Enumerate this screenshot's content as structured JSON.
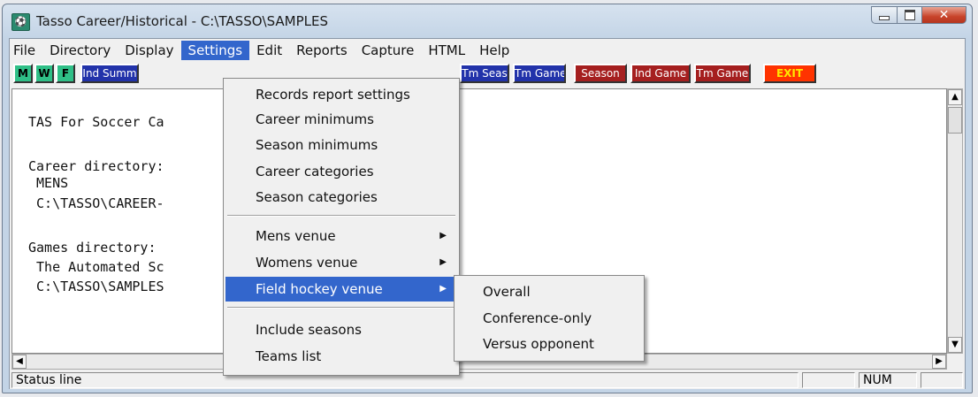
{
  "window": {
    "title": "Tasso Career/Historical - C:\\TASSO\\SAMPLES",
    "app_icon_glyph": "⚽"
  },
  "menubar": {
    "items": [
      "File",
      "Directory",
      "Display",
      "Settings",
      "Edit",
      "Reports",
      "Capture",
      "HTML",
      "Help"
    ],
    "active": "Settings"
  },
  "toolbar": {
    "buttons": [
      {
        "label": "M",
        "color": "green"
      },
      {
        "label": "W",
        "color": "green"
      },
      {
        "label": "F",
        "color": "green"
      },
      {
        "label": "Ind Summ",
        "color": "blue"
      },
      {
        "label": "Tm Seas",
        "color": "blue"
      },
      {
        "label": "Tm Game",
        "color": "blue"
      },
      {
        "label": "Season",
        "color": "red"
      },
      {
        "label": "Ind Game",
        "color": "red"
      },
      {
        "label": "Tm Game",
        "color": "red"
      },
      {
        "label": "EXIT",
        "color": "exit"
      }
    ]
  },
  "content": {
    "lines": [
      "TAS For Soccer Ca",
      "Career directory:",
      " MENS",
      " C:\\TASSO\\CAREER-",
      "Games directory:",
      " The Automated Sc",
      " C:\\TASSO\\SAMPLES"
    ]
  },
  "settings_menu": {
    "items": [
      {
        "label": "Records report settings"
      },
      {
        "label": "Career minimums"
      },
      {
        "label": "Season minimums"
      },
      {
        "label": "Career categories"
      },
      {
        "label": "Season categories"
      },
      {
        "label": "Mens venue",
        "submenu": true
      },
      {
        "label": "Womens venue",
        "submenu": true
      },
      {
        "label": "Field hockey venue",
        "submenu": true,
        "highlighted": true
      },
      {
        "label": "Include seasons"
      },
      {
        "label": "Teams list"
      }
    ]
  },
  "venue_submenu": {
    "items": [
      "Overall",
      "Conference-only",
      "Versus opponent"
    ]
  },
  "statusbar": {
    "text": "Status line",
    "num": "NUM"
  },
  "colors": {
    "menu_highlight": "#3366cc",
    "toolbar_green": "#2fbf87",
    "toolbar_blue": "#2233aa",
    "toolbar_red": "#a51f1f",
    "exit_button": "#ff3300"
  },
  "icons": [
    "app-icon",
    "minimize-icon",
    "maximize-icon",
    "close-icon",
    "arrow-up-icon",
    "arrow-down-icon",
    "arrow-left-icon",
    "arrow-right-icon",
    "submenu-arrow-icon"
  ]
}
